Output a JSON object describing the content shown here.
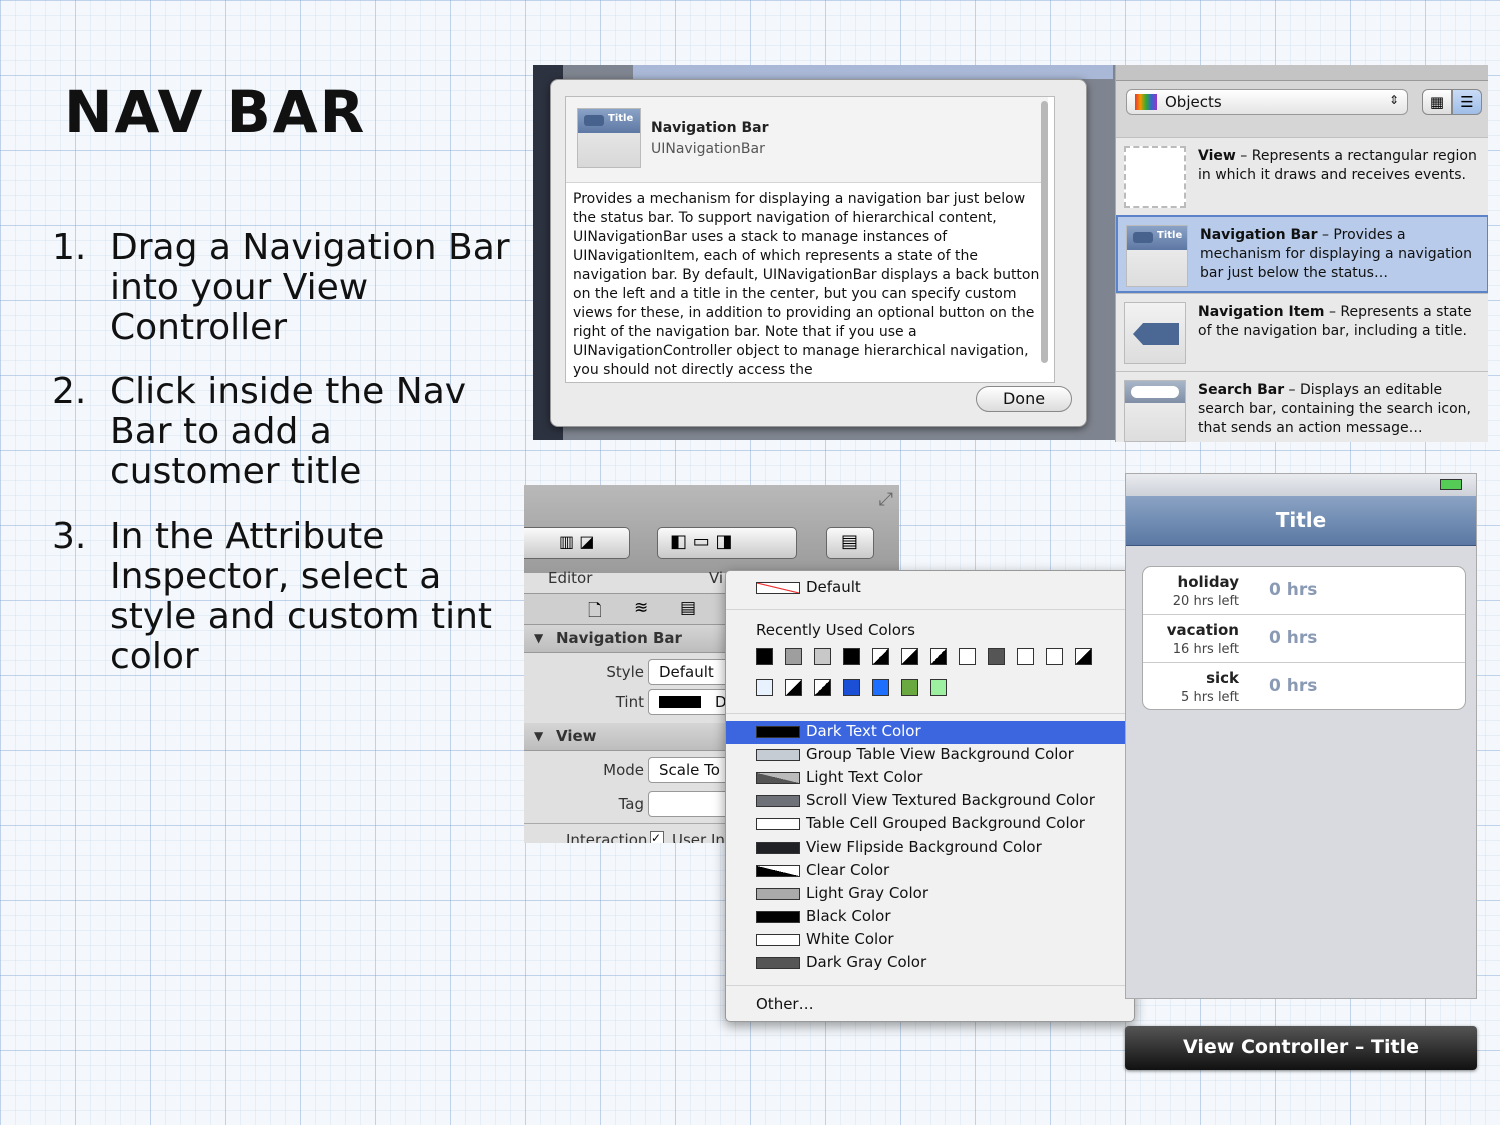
{
  "slide": {
    "title": "NAV BAR",
    "steps": [
      {
        "num": "1.",
        "text": "Drag a Navigation Bar into your View Controller"
      },
      {
        "num": "2.",
        "text": "Click inside the Nav Bar to add a customer title"
      },
      {
        "num": "3.",
        "text": "In the Attribute Inspector, select a style and custom tint color"
      }
    ]
  },
  "popover": {
    "thumb_label": "Title",
    "name": "Navigation Bar",
    "class_name": "UINavigationBar",
    "description": "Provides a mechanism for displaying a navigation bar just below the status bar. To support navigation of hierarchical content, UINavigationBar uses a stack to manage instances of UINavigationItem, each of which represents a state of the navigation bar. By default, UINavigationBar displays a back button on the left and a title in the center, but you can specify custom views for these, in addition to providing an optional button on the right of the navigation bar. Note that if you use a UINavigationController object to manage hierarchical navigation, you should not directly access the",
    "done_label": "Done"
  },
  "library": {
    "select_label": "Objects",
    "items": [
      {
        "title": "View",
        "desc": " – Represents a rectangular region in which it draws and receives events."
      },
      {
        "title": "Navigation Bar",
        "desc": " – Provides a mechanism for displaying a navigation bar just below the status…",
        "thumb_label": "Title"
      },
      {
        "title": "Navigation Item",
        "desc": " – Represents a state of the navigation bar, including a title."
      },
      {
        "title": "Search Bar",
        "desc": " – Displays an editable search bar, containing the search icon, that sends an action message…"
      }
    ]
  },
  "inspector": {
    "editor_label": "Editor",
    "view_label_partial": "Vi",
    "nav_section": "Navigation Bar",
    "style_label": "Style",
    "style_value": "Default",
    "tint_label": "Tint",
    "tint_value_partial": "D",
    "view_section": "View",
    "mode_label": "Mode",
    "mode_value": "Scale To",
    "tag_label": "Tag",
    "interaction_label": "Interaction",
    "user_partial": "User In"
  },
  "color_menu": {
    "default_label": "Default",
    "recent_header": "Recently Used Colors",
    "items": [
      {
        "label": "Dark Text Color",
        "color": "#000000"
      },
      {
        "label": "Group Table View Background Color",
        "color": "#c5ccd4"
      },
      {
        "label": "Light Text Color",
        "color": "#999999"
      },
      {
        "label": "Scroll View Textured Background Color",
        "color": "#6f7178"
      },
      {
        "label": "Table Cell Grouped Background Color",
        "color": "#ffffff"
      },
      {
        "label": "View Flipside Background Color",
        "color": "#1f2124"
      },
      {
        "label": "Clear Color",
        "color": "#ffffff"
      },
      {
        "label": "Light Gray Color",
        "color": "#aaaaaa"
      },
      {
        "label": "Black Color",
        "color": "#000000"
      },
      {
        "label": "White Color",
        "color": "#ffffff"
      },
      {
        "label": "Dark Gray Color",
        "color": "#555555"
      }
    ],
    "other_label": "Other…",
    "recent_row1": [
      "#000000",
      "#9e9e9e",
      "#c8c8c8",
      "#000000",
      "half",
      "half",
      "half",
      "#ffffff",
      "#555555",
      "#ffffff",
      "#ffffff",
      "half"
    ],
    "recent_row2": [
      "#e8f2ff",
      "half",
      "half",
      "#1a4fd6",
      "#1f6fff",
      "#6aa840",
      "#9df0a0"
    ]
  },
  "phone": {
    "nav_title": "Title",
    "rows": [
      {
        "key": "holiday",
        "sub": "20 hrs left",
        "value": "0 hrs"
      },
      {
        "key": "vacation",
        "sub": "16 hrs left",
        "value": "0 hrs"
      },
      {
        "key": "sick",
        "sub": "5 hrs left",
        "value": "0 hrs"
      }
    ],
    "vc_label": "View Controller – Title"
  }
}
